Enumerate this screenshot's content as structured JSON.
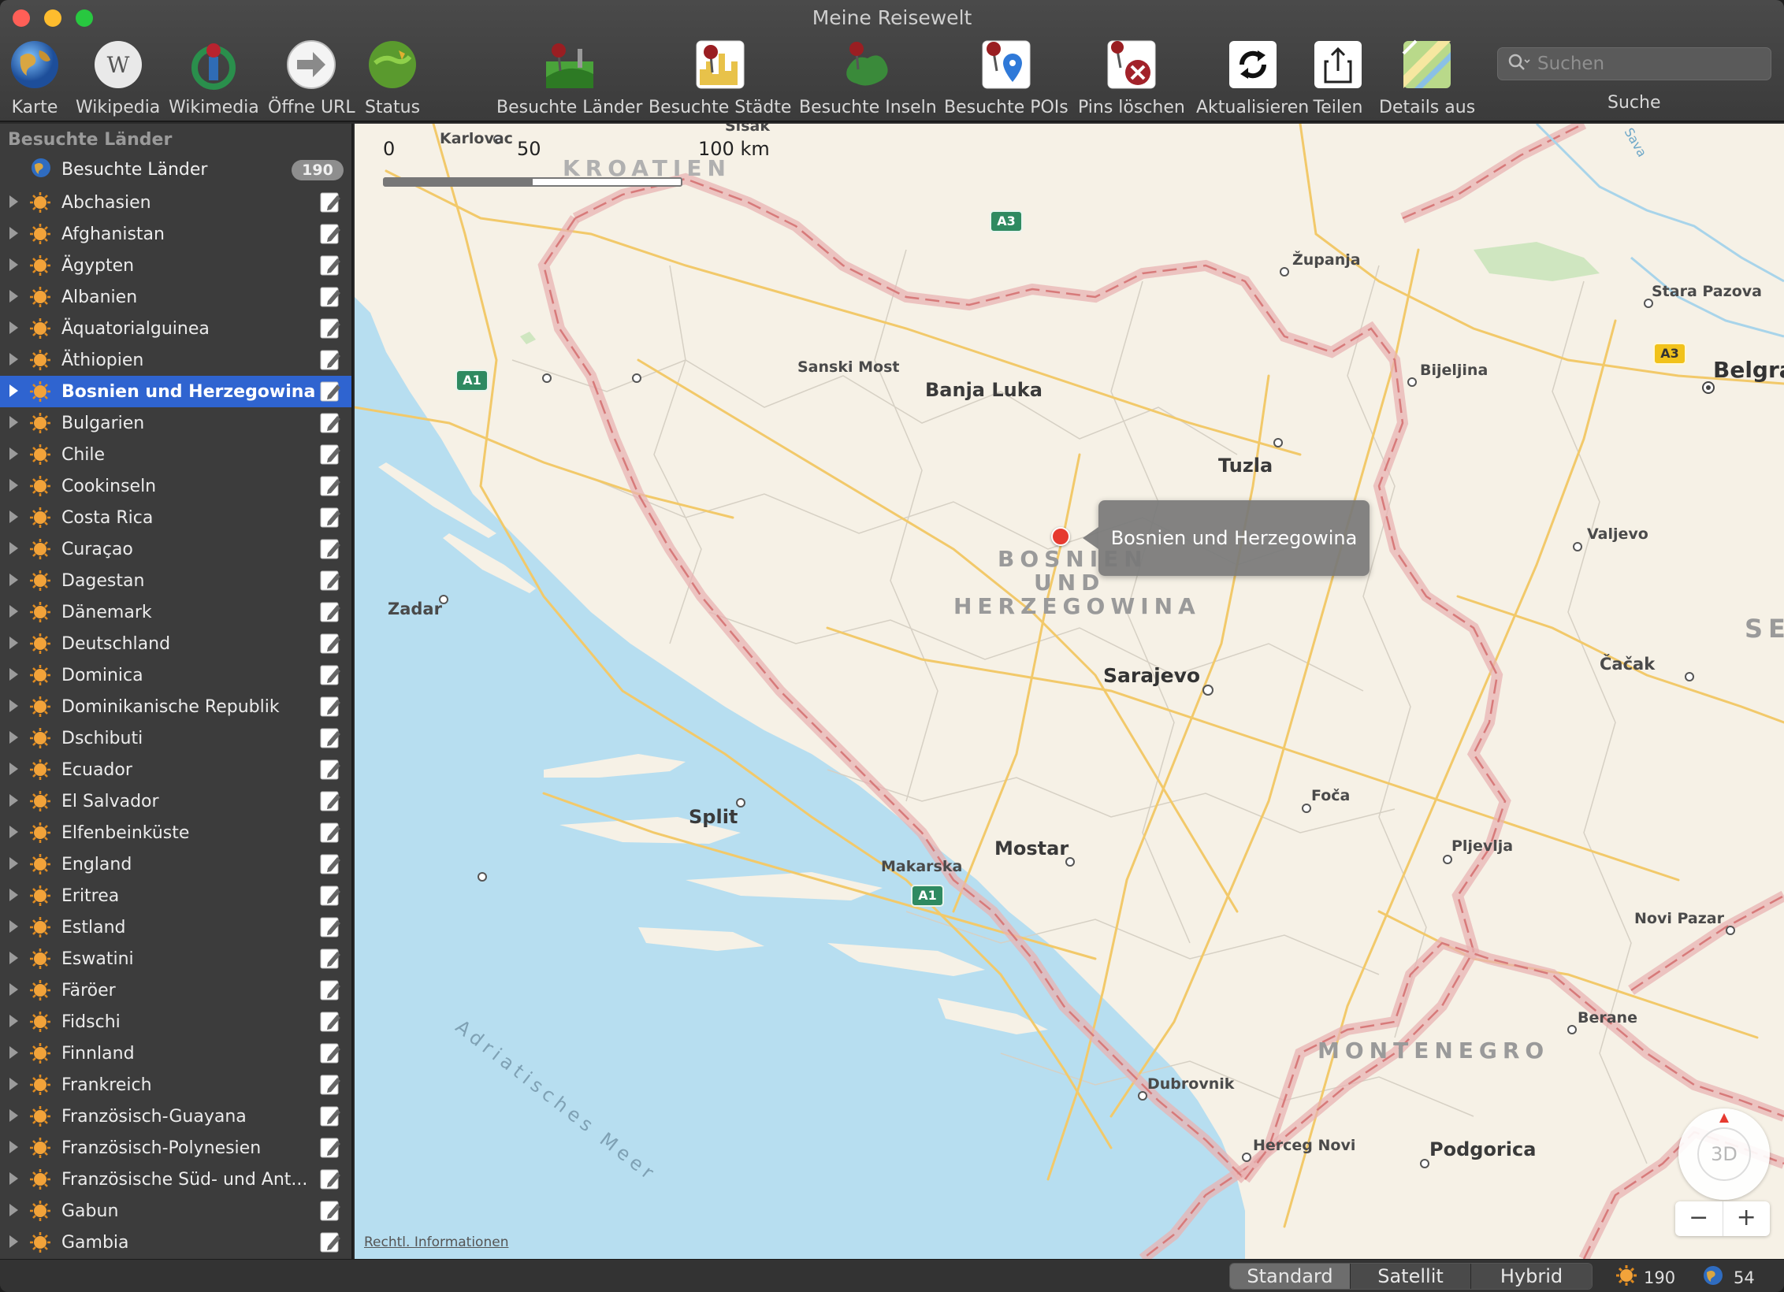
{
  "window": {
    "title": "Meine Reisewelt"
  },
  "toolbar": {
    "items": [
      {
        "label": "Karte",
        "icon": "globe-icon"
      },
      {
        "label": "Wikipedia",
        "icon": "wikipedia-icon"
      },
      {
        "label": "Wikimedia",
        "icon": "wikimedia-icon"
      },
      {
        "label": "Öffne URL",
        "icon": "arrow-right-icon"
      },
      {
        "label": "Status",
        "icon": "status-globe-icon"
      },
      {
        "label": "Besuchte Länder",
        "icon": "countries-pin-icon"
      },
      {
        "label": "Besuchte Städte",
        "icon": "cities-pin-icon"
      },
      {
        "label": "Besuchte Inseln",
        "icon": "islands-pin-icon"
      },
      {
        "label": "Besuchte POIs",
        "icon": "pois-pin-icon"
      },
      {
        "label": "Pins löschen",
        "icon": "delete-pins-icon"
      },
      {
        "label": "Aktualisieren",
        "icon": "refresh-icon"
      },
      {
        "label": "Teilen",
        "icon": "share-icon"
      },
      {
        "label": "Details aus",
        "icon": "map-details-icon"
      }
    ],
    "search": {
      "placeholder": "Suchen",
      "label": "Suche"
    }
  },
  "sidebar": {
    "header": "Besuchte Länder",
    "root": {
      "label": "Besuchte Länder",
      "count": "190"
    },
    "selected_index": 6,
    "items": [
      "Abchasien",
      "Afghanistan",
      "Ägypten",
      "Albanien",
      "Äquatorialguinea",
      "Äthiopien",
      "Bosnien und Herzegowina",
      "Bulgarien",
      "Chile",
      "Cookinseln",
      "Costa Rica",
      "Curaçao",
      "Dagestan",
      "Dänemark",
      "Deutschland",
      "Dominica",
      "Dominikanische Republik",
      "Dschibuti",
      "Ecuador",
      "El Salvador",
      "Elfenbeinküste",
      "England",
      "Eritrea",
      "Estland",
      "Eswatini",
      "Färöer",
      "Fidschi",
      "Finnland",
      "Frankreich",
      "Französisch-Guayana",
      "Französisch-Polynesien",
      "Französische Süd- und Ant...",
      "Gabun",
      "Gambia"
    ]
  },
  "map": {
    "scale": {
      "zero": "0",
      "mid": "50",
      "end": "100 km"
    },
    "callout": "Bosnien und Herzegowina",
    "legal": "Rechtl. Informationen",
    "compass": "3D",
    "zoom_out": "−",
    "zoom_in": "+",
    "labels": {
      "karlovac": "Karlovac",
      "sisak": "Sisak",
      "kroatien": "KROATIEN",
      "zupanja": "Županja",
      "stara_pazova": "Stara Pazova",
      "belgrad": "Belgra",
      "sanski_most": "Sanski Most",
      "banja_luka": "Banja Luka",
      "bijeljina": "Bijeljina",
      "tuzla": "Tuzla",
      "valjevo": "Valjevo",
      "bosnien_1": "BOSNIEN",
      "bosnien_2": "UND",
      "bosnien_3": "HERZEGOWINA",
      "zadar": "Zadar",
      "serbien": "SER",
      "cacak": "Čačak",
      "sarajevo": "Sarajevo",
      "foca": "Foča",
      "split": "Split",
      "mostar": "Mostar",
      "pljevlja": "Pljevlja",
      "makarska": "Makarska",
      "novi_pazar": "Novi Pazar",
      "berane": "Berane",
      "montenegro": "MONTENEGRO",
      "dubrovnik": "Dubrovnik",
      "herceg_novi": "Herceg Novi",
      "podgorica": "Podgorica",
      "meer": "Adriatisches Meer",
      "sava": "Sava"
    },
    "shields": {
      "a1": "A1",
      "a3": "A3"
    }
  },
  "statusbar": {
    "map_types": [
      "Standard",
      "Satellit",
      "Hybrid"
    ],
    "active_map_type": "Standard",
    "visited_countries": "190",
    "visited_other": "54"
  },
  "colors": {
    "accent": "#2f64d0",
    "border_pink": "#e8a6a6",
    "water": "#b7def0",
    "land": "#f6f1e6",
    "road": "#f2c96a"
  }
}
